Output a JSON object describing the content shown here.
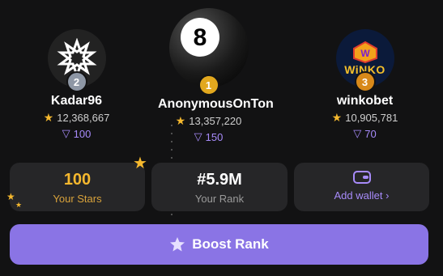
{
  "leaderboard": [
    {
      "place": "2",
      "name": "Kadar96",
      "stars": "12,368,667",
      "ton": "100",
      "badge_color": "#8e97a5"
    },
    {
      "place": "1",
      "name": "AnonymousOnTon",
      "stars": "13,357,220",
      "ton": "150",
      "badge_color": "#e2a81e"
    },
    {
      "place": "3",
      "name": "winkobet",
      "stars": "10,905,781",
      "ton": "70",
      "badge_color": "#d8891a"
    }
  ],
  "avatar_logo_text": "WiNKO",
  "stats": {
    "stars_value": "100",
    "stars_label": "Your Stars",
    "rank_value": "#5.9M",
    "rank_label": "Your Rank",
    "wallet_label": "Add wallet"
  },
  "boost_label": "Boost Rank",
  "colors": {
    "accent": "#8a74e5",
    "gold": "#f5b82e",
    "ton": "#a78bfa"
  }
}
